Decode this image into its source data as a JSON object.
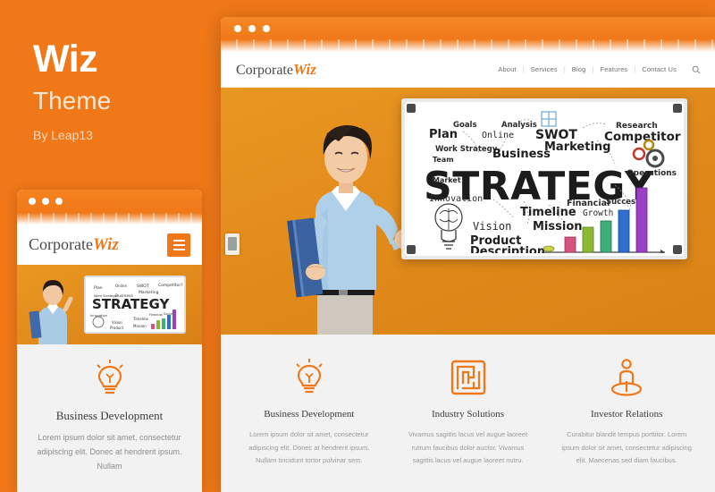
{
  "theme_promo": {
    "title": "Wiz",
    "subtitle": "Theme",
    "author": "By Leap13",
    "accent_color": "#F07818",
    "background_color": "#F07818"
  },
  "browser_window": {
    "titlebar_dots": [
      "dot",
      "dot",
      "dot"
    ],
    "site": {
      "logo": {
        "primary": "Corporate",
        "accent": "Wiz"
      },
      "nav": {
        "items": [
          "About",
          "Services",
          "Blog",
          "Features",
          "Contact Us"
        ],
        "separator": "|",
        "search_icon": "search-icon"
      },
      "hero": {
        "whiteboard": {
          "headline": "STRATEGY",
          "words": [
            "Goals",
            "Analysis",
            "Research",
            "Plan",
            "Online",
            "SWOT",
            "Competitor?",
            "Work Strategy",
            "Marketing",
            "Business",
            "Team",
            "Operations",
            "Market",
            "Innovation",
            "Financial",
            "Success",
            "Growth",
            "Timeline",
            "Vision",
            "Mission",
            "Product",
            "Description"
          ],
          "chart_bars": [
            "#C9D14A",
            "#D4567E",
            "#8DB836",
            "#3EAE7A",
            "#2E6FD1",
            "#9B3FC4"
          ]
        },
        "subject": "businesswoman-with-pen-and-folder"
      },
      "features": [
        {
          "icon": "lightbulb-icon",
          "title": "Business Development",
          "body": "Lorem ipsum dolor sit amet, consectetur adipiscing elit. Donec at hendrerit ipsum. Nullam tincidunt tortor pulvinar sem."
        },
        {
          "icon": "maze-icon",
          "title": "Industry Solutions",
          "body": "Vivamus sagittis lacus vel augue laoreet rutrum faucibus dolor auctor. Vivamus sagittis lacus vel augue laoreet nutru."
        },
        {
          "icon": "investor-icon",
          "title": "Investor Relations",
          "body": "Curabitur blandit tempus porttitor. Lorem ipsum dolor sit amet, consectetur adipiscing elit. Maecenas sed diam faucibus."
        }
      ]
    }
  },
  "mobile_mockup": {
    "titlebar_dots": [
      "dot",
      "dot",
      "dot"
    ],
    "logo": {
      "primary": "Corporate",
      "accent": "Wiz"
    },
    "menu_icon": "hamburger-menu-icon",
    "feature": {
      "icon": "lightbulb-icon",
      "title": "Business Development",
      "body": "Lorem ipsum dolor sit amet, consectetur adipiscing elit. Donec at hendrerit ipsum. Nullam"
    }
  }
}
